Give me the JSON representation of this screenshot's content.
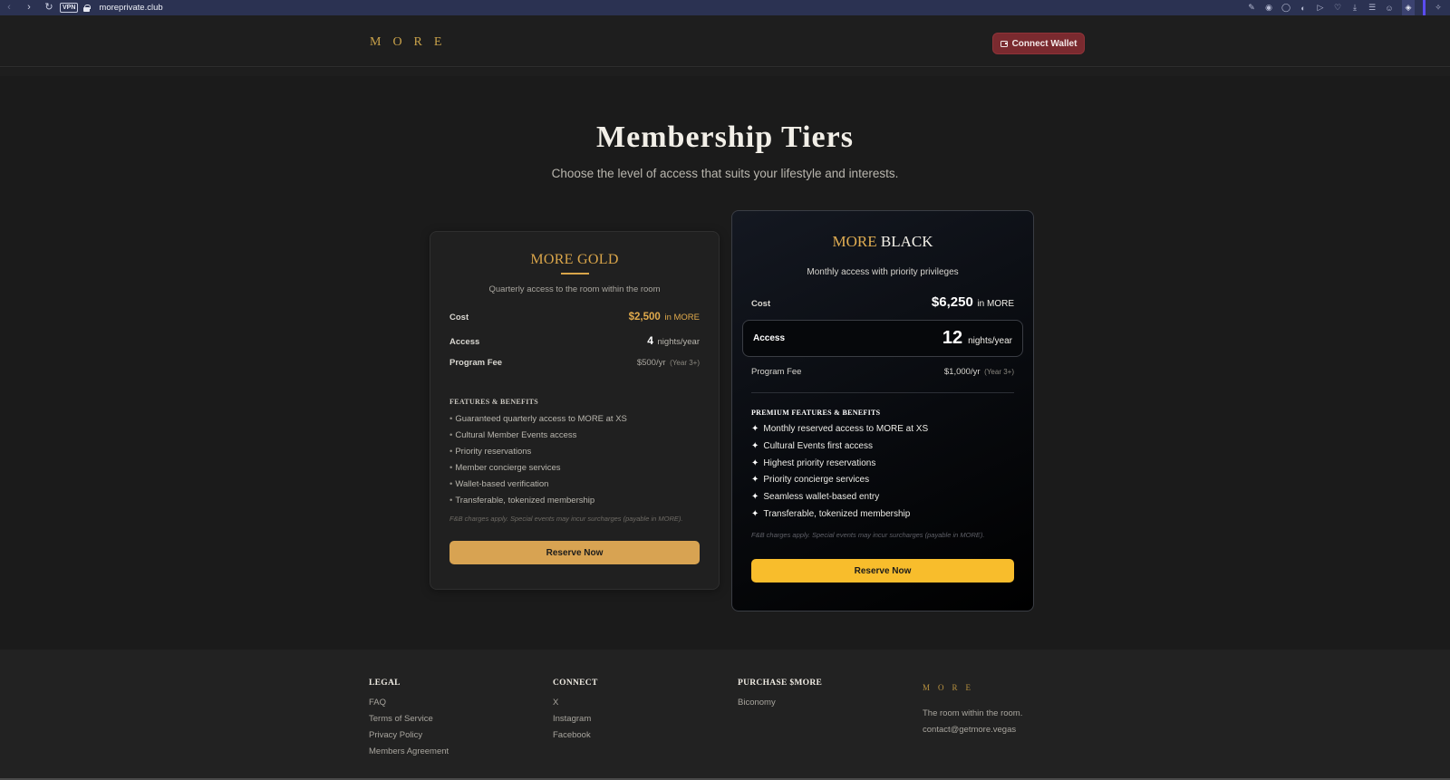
{
  "browser": {
    "url": "moreprivate.club",
    "vpn_label": "VPN"
  },
  "header": {
    "logo": "MORE",
    "connect_label": "Connect Wallet"
  },
  "hero": {
    "title": "Membership Tiers",
    "subtitle": "Choose the level of access that suits your lifestyle and interests."
  },
  "gold": {
    "name": "MORE GOLD",
    "description": "Quarterly access to the room within the room",
    "cost_label": "Cost",
    "cost_value": "$2,500",
    "cost_unit": "in MORE",
    "access_label": "Access",
    "access_value": "4",
    "access_unit": "nights/year",
    "fee_label": "Program Fee",
    "fee_value": "$500/yr",
    "fee_note": "(Year 3+)",
    "features_title": "FEATURES & BENEFITS",
    "features": [
      "Guaranteed quarterly access to MORE at XS",
      "Cultural Member Events access",
      "Priority reservations",
      "Member concierge services",
      "Wallet-based verification",
      "Transferable, tokenized membership"
    ],
    "note": "F&B charges apply. Special events may incur surcharges (payable in MORE).",
    "button": "Reserve Now"
  },
  "black": {
    "name_a": "MORE",
    "name_b": "BLACK",
    "description": "Monthly access with priority privileges",
    "cost_label": "Cost",
    "cost_value": "$6,250",
    "cost_unit": "in MORE",
    "access_label": "Access",
    "access_value": "12",
    "access_unit": "nights/year",
    "fee_label": "Program Fee",
    "fee_value": "$1,000/yr",
    "fee_note": "(Year 3+)",
    "features_title": "PREMIUM FEATURES & BENEFITS",
    "features": [
      "Monthly reserved access to MORE at XS",
      "Cultural Events first access",
      "Highest priority reservations",
      "Priority concierge services",
      "Seamless wallet-based entry",
      "Transferable, tokenized membership"
    ],
    "note": "F&B charges apply. Special events may incur surcharges (payable in MORE).",
    "button": "Reserve Now"
  },
  "footer": {
    "legal": {
      "title": "LEGAL",
      "links": [
        "FAQ",
        "Terms of Service",
        "Privacy Policy",
        "Members Agreement"
      ]
    },
    "connect": {
      "title": "CONNECT",
      "links": [
        "X",
        "Instagram",
        "Facebook"
      ]
    },
    "purchase": {
      "title": "PURCHASE $MORE",
      "links": [
        "Biconomy"
      ]
    },
    "brand": {
      "logo": "MORE",
      "tagline": "The room within the room.",
      "email": "contact@getmore.vegas"
    }
  }
}
